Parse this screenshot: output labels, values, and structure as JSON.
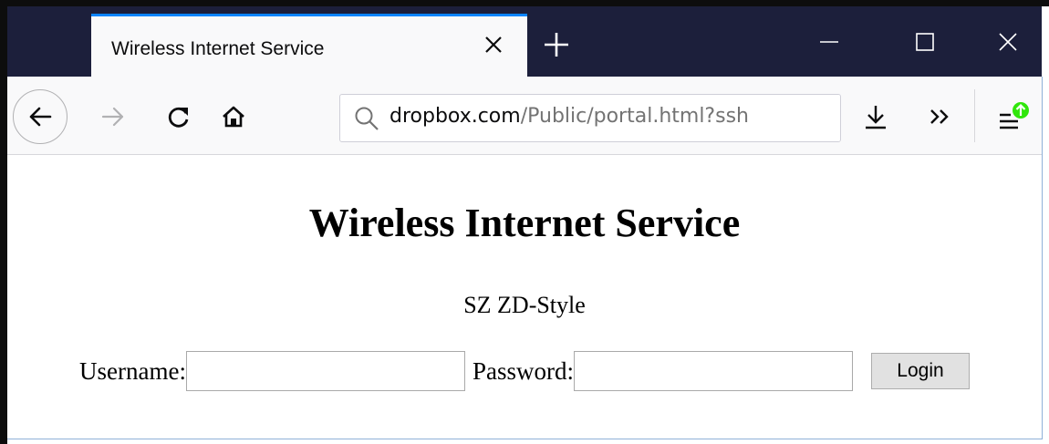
{
  "browser": {
    "tab": {
      "title": "Wireless Internet Service"
    },
    "url": {
      "domain": "dropbox.com",
      "path": "/Public/portal.html?ssh"
    },
    "window_controls": {
      "minimize": "minimize-icon",
      "maximize": "maximize-icon",
      "close": "close-icon"
    },
    "toolbar_icons": [
      "back-arrow-icon",
      "forward-arrow-icon",
      "reload-icon",
      "home-icon",
      "search-icon",
      "download-icon",
      "overflow-chevron-icon",
      "hamburger-menu-icon",
      "update-badge-icon"
    ],
    "colors": {
      "titlebar": "#1c1f3b",
      "tab_accent": "#0a84ff",
      "update_badge": "#30e60b"
    }
  },
  "page": {
    "title": "Wireless Internet Service",
    "subtitle": "SZ ZD-Style",
    "form": {
      "username_label": "Username:",
      "username_value": "",
      "password_label": "Password:",
      "password_value": "",
      "login_label": "Login"
    }
  }
}
